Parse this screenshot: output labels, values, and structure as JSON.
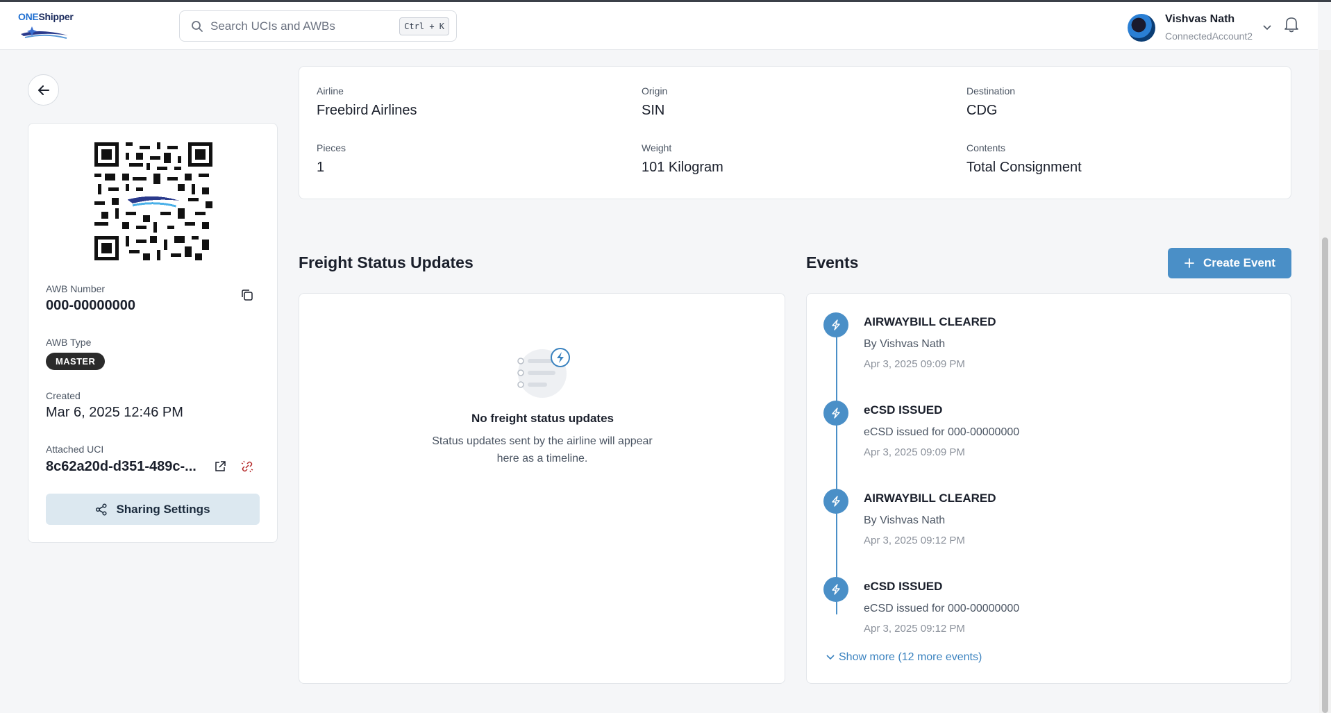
{
  "header": {
    "logo": {
      "part1": "ONE",
      "part2": "Shipper"
    },
    "search_placeholder": "Search UCIs and AWBs",
    "shortcut": "Ctrl + K",
    "user": {
      "name": "Vishvas Nath",
      "account": "ConnectedAccount2"
    }
  },
  "awb": {
    "number_label": "AWB Number",
    "number": "000-00000000",
    "type_label": "AWB Type",
    "type": "MASTER",
    "created_label": "Created",
    "created": "Mar 6, 2025 12:46 PM",
    "uci_label": "Attached UCI",
    "uci": "8c62a20d-d351-489c-...",
    "sharing_label": "Sharing Settings"
  },
  "info": {
    "airline": {
      "label": "Airline",
      "value": "Freebird Airlines"
    },
    "origin": {
      "label": "Origin",
      "value": "SIN"
    },
    "destination": {
      "label": "Destination",
      "value": "CDG"
    },
    "pieces": {
      "label": "Pieces",
      "value": "1"
    },
    "weight": {
      "label": "Weight",
      "value": "101 Kilogram"
    },
    "contents": {
      "label": "Contents",
      "value": "Total Consignment"
    }
  },
  "freight": {
    "title": "Freight Status Updates",
    "empty_title": "No freight status updates",
    "empty_desc": "Status updates sent by the airline will appear here as a timeline."
  },
  "events": {
    "title": "Events",
    "create_label": "Create Event",
    "items": [
      {
        "title": "AIRWAYBILL CLEARED",
        "desc": "By Vishvas Nath",
        "time": "Apr 3, 2025 09:09 PM"
      },
      {
        "title": "eCSD ISSUED",
        "desc": "eCSD issued for 000-00000000",
        "time": "Apr 3, 2025 09:09 PM"
      },
      {
        "title": "AIRWAYBILL CLEARED",
        "desc": "By Vishvas Nath",
        "time": "Apr 3, 2025 09:12 PM"
      },
      {
        "title": "eCSD ISSUED",
        "desc": "eCSD issued for 000-00000000",
        "time": "Apr 3, 2025 09:12 PM"
      }
    ],
    "show_more": "Show more (12 more events)"
  },
  "colors": {
    "accent": "#4a8fc7",
    "badge": "#2b2b2b",
    "share_bg": "#dce8f0"
  }
}
